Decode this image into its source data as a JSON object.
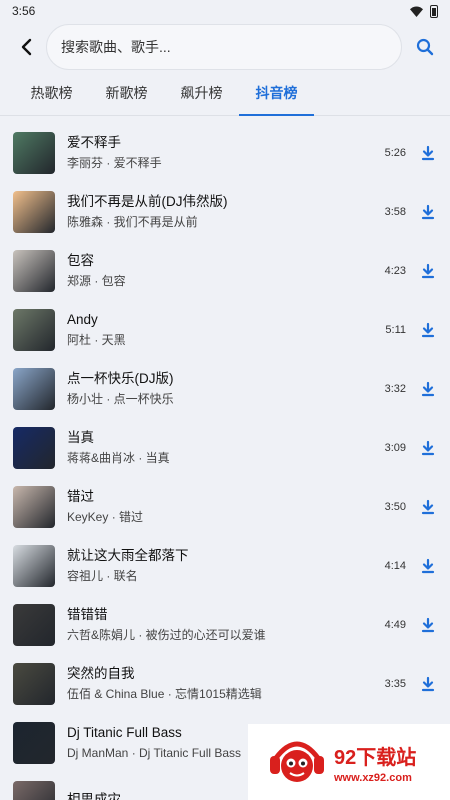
{
  "status": {
    "time": "3:56"
  },
  "search": {
    "placeholder": "搜索歌曲、歌手..."
  },
  "tabs": [
    {
      "label": "热歌榜"
    },
    {
      "label": "新歌榜"
    },
    {
      "label": "飙升榜"
    },
    {
      "label": "抖音榜"
    }
  ],
  "active_tab": "抖音榜",
  "songs": [
    {
      "title": "爱不释手",
      "subtitle": "李丽芬 · 爱不释手",
      "duration": "5:26",
      "cover": "#4f7a63"
    },
    {
      "title": "我们不再是从前(DJ伟然版)",
      "subtitle": "陈雅森 · 我们不再是从前",
      "duration": "3:58",
      "cover": "#f2c08c"
    },
    {
      "title": "包容",
      "subtitle": "郑源 · 包容",
      "duration": "4:23",
      "cover": "#c9c3bd"
    },
    {
      "title": "Andy",
      "subtitle": "阿杜 · 天黑",
      "duration": "5:11",
      "cover": "#6d7868"
    },
    {
      "title": "点一杯快乐(DJ版)",
      "subtitle": "杨小壮 · 点一杯快乐",
      "duration": "3:32",
      "cover": "#8aa6c9"
    },
    {
      "title": "当真",
      "subtitle": "蒋蒋&曲肖冰 · 当真",
      "duration": "3:09",
      "cover": "#162a66"
    },
    {
      "title": "错过",
      "subtitle": "KeyKey · 错过",
      "duration": "3:50",
      "cover": "#c9b8ad"
    },
    {
      "title": "就让这大雨全都落下",
      "subtitle": "容祖儿 · 联名",
      "duration": "4:14",
      "cover": "#d8dde2"
    },
    {
      "title": "错错错",
      "subtitle": "六哲&陈娟儿 · 被伤过的心还可以爱谁",
      "duration": "4:49",
      "cover": "#3a3a3a"
    },
    {
      "title": "突然的自我",
      "subtitle": "伍佰 & China Blue · 忘情1015精选辑",
      "duration": "3:35",
      "cover": "#4a4a40"
    },
    {
      "title": "Dj Titanic Full Bass",
      "subtitle": "Dj ManMan · Dj Titanic Full Bass",
      "duration": "",
      "cover": "#1c2530"
    },
    {
      "title": "相思成灾",
      "subtitle": "",
      "duration": "",
      "cover": "#7a6a68"
    }
  ],
  "watermark": {
    "name": "92下载站",
    "url": "www.xz92.com"
  },
  "colors": {
    "accent": "#1f6fd9",
    "background": "#eff1f6",
    "watermark": "#d9201d"
  }
}
